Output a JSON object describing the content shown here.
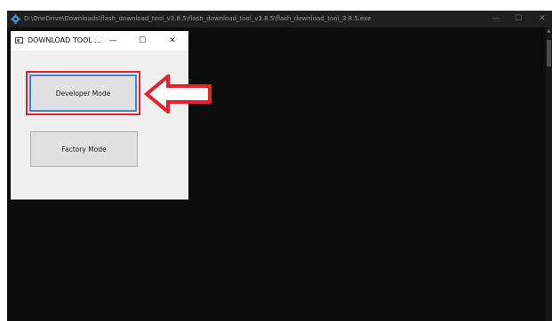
{
  "console": {
    "title": "D:\\OneDrive\\Downloads\\flash_download_tool_v3.8.5\\flash_download_tool_v3.8.5\\flash_download_tool_3.8.5.exe",
    "minimize_glyph": "—",
    "maximize_glyph": "☐",
    "close_glyph": "✕",
    "background_color": "#0c0c0c"
  },
  "dialog": {
    "title": "DOWNLOAD TOOL ...",
    "minimize_glyph": "—",
    "maximize_glyph": "☐",
    "close_glyph": "✕",
    "buttons": {
      "developer_mode": "Developer Mode",
      "factory_mode": "Factory Mode"
    }
  },
  "annotation": {
    "highlight_color": "#e8202a",
    "arrow_icon": "left-arrow-icon"
  }
}
